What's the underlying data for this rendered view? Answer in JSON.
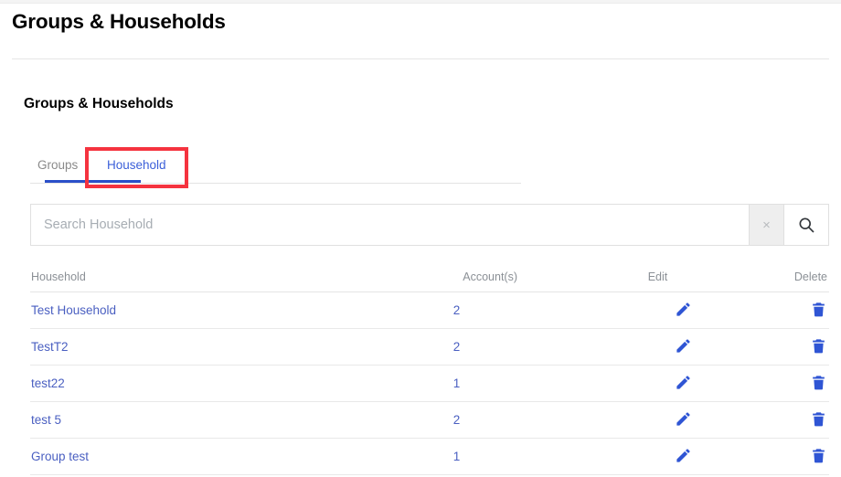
{
  "page": {
    "title": "Groups & Households",
    "section_title": "Groups & Households"
  },
  "tabs": {
    "items": [
      {
        "label": "Groups",
        "active": false
      },
      {
        "label": "Household",
        "active": true
      }
    ],
    "active_color": "#3b5fd9",
    "inactive_color": "#8a8a8a",
    "underline_color": "#2b4fc9",
    "highlight_box_color": "#f5333f"
  },
  "search": {
    "placeholder": "Search Household",
    "value": "",
    "clear_icon": "close-icon",
    "clear_glyph": "×",
    "search_icon": "search-icon"
  },
  "table": {
    "columns": [
      {
        "key": "household",
        "label": "Household"
      },
      {
        "key": "accounts",
        "label": "Account(s)"
      },
      {
        "key": "edit",
        "label": "Edit"
      },
      {
        "key": "delete",
        "label": "Delete"
      }
    ],
    "link_color": "#4a5fc1",
    "action_icon_color": "#2f55d4",
    "rows": [
      {
        "household": "Test Household",
        "accounts": "2",
        "edit_icon": "pencil-icon",
        "delete_icon": "trash-icon"
      },
      {
        "household": "TestT2",
        "accounts": "2",
        "edit_icon": "pencil-icon",
        "delete_icon": "trash-icon"
      },
      {
        "household": "test22",
        "accounts": "1",
        "edit_icon": "pencil-icon",
        "delete_icon": "trash-icon"
      },
      {
        "household": "test 5",
        "accounts": "2",
        "edit_icon": "pencil-icon",
        "delete_icon": "trash-icon"
      },
      {
        "household": "Group test",
        "accounts": "1",
        "edit_icon": "pencil-icon",
        "delete_icon": "trash-icon"
      }
    ]
  }
}
